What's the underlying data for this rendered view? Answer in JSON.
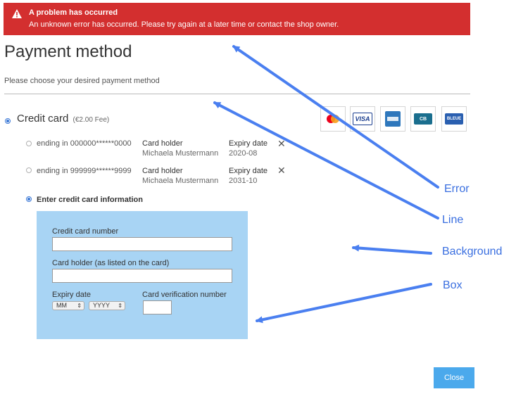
{
  "error": {
    "title": "A problem has occurred",
    "message": "An unknown error has occurred. Please try again at a later time or contact the shop owner."
  },
  "page": {
    "title": "Payment method",
    "subtitle": "Please choose your desired payment method"
  },
  "credit_card": {
    "label": "Credit card",
    "fee": "(€2.00 Fee)",
    "logos": [
      "mastercard",
      "VISA",
      "amex",
      "CB",
      "BLEUE"
    ]
  },
  "saved_cards": [
    {
      "ending": "ending in 000000******0000",
      "holder_label": "Card holder",
      "holder": "Michaela Mustermann",
      "expiry_label": "Expiry date",
      "expiry": "2020-08",
      "remove": "✕"
    },
    {
      "ending": "ending in 999999******9999",
      "holder_label": "Card holder",
      "holder": "Michaela Mustermann",
      "expiry_label": "Expiry date",
      "expiry": "2031-10",
      "remove": "✕"
    }
  ],
  "new_card": {
    "label": "Enter credit card information",
    "number_label": "Credit card number",
    "holder_label": "Card holder (as listed on the card)",
    "expiry_label": "Expiry date",
    "month_placeholder": "MM",
    "year_placeholder": "YYYY",
    "cvv_label": "Card verification number"
  },
  "annotations": {
    "error": "Error",
    "line": "Line",
    "background": "Background",
    "box": "Box"
  },
  "footer": {
    "close_label": "Close"
  },
  "colors": {
    "error_bg": "#d32f2f",
    "form_bg": "#a8d4f4",
    "accent": "#3a78d6",
    "annotation": "#3a6fe0",
    "close_button": "#4ba9ec"
  }
}
